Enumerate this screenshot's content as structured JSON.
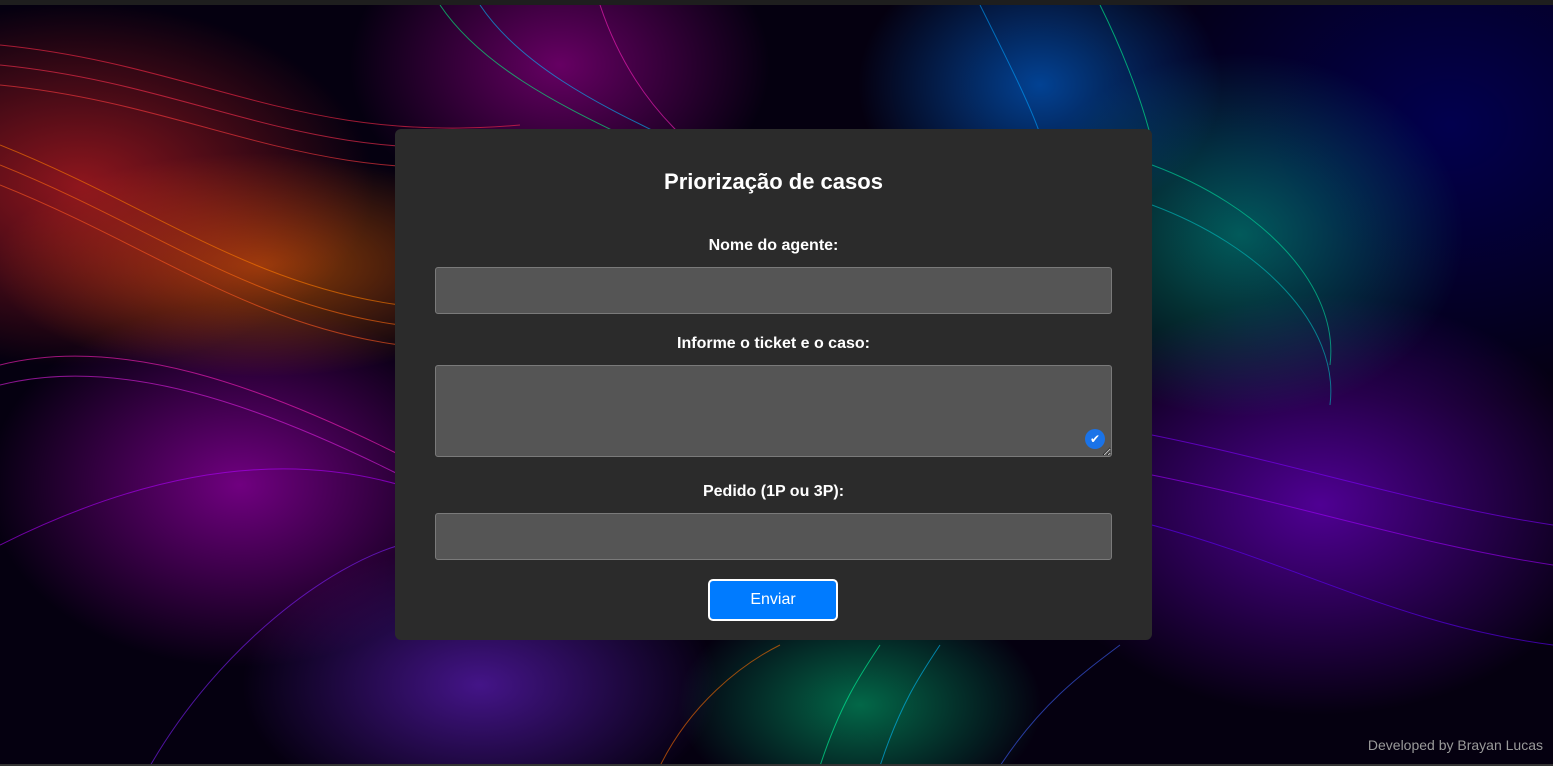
{
  "form": {
    "title": "Priorização de casos",
    "agent_label": "Nome do agente:",
    "agent_value": "",
    "ticket_label": "Informe o ticket e o caso:",
    "ticket_value": "",
    "order_label": "Pedido (1P ou 3P):",
    "order_value": "",
    "submit_label": "Enviar"
  },
  "footer": {
    "credit": "Developed by Brayan Lucas"
  },
  "colors": {
    "card_background": "#2b2b2b",
    "field_background": "#555555",
    "button_accent": "#007bff",
    "grammar_check_icon": "#1a73e8"
  },
  "icons": {
    "textarea_badge": "check-circle-icon"
  }
}
